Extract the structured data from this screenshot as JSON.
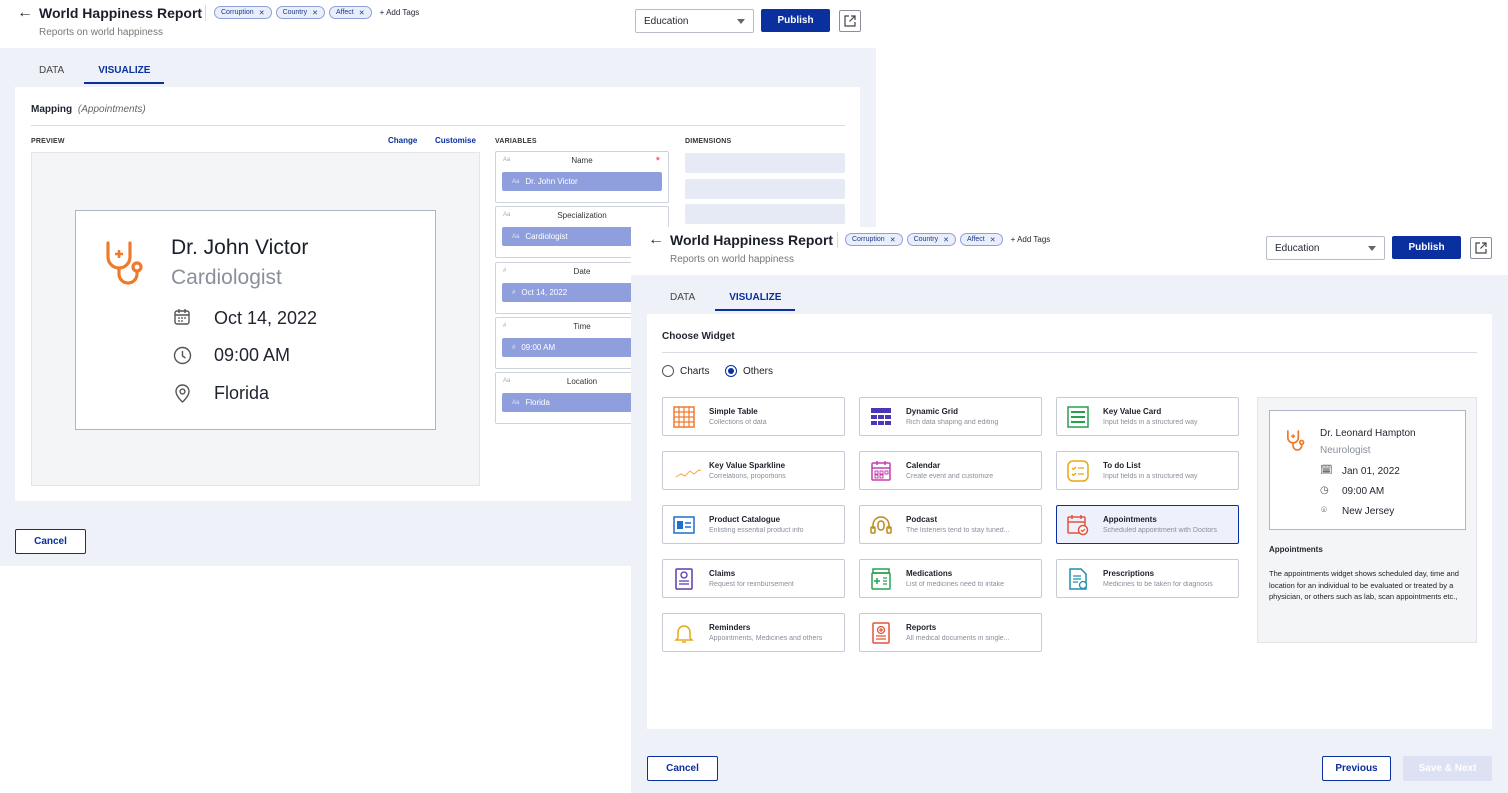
{
  "report": {
    "title": "World Happiness Report",
    "subtitle": "Reports on world happiness",
    "tags": [
      "Corruption",
      "Country",
      "Affect"
    ],
    "add_tags": "+ Add Tags",
    "category": "Education",
    "publish": "Publish"
  },
  "tabs": [
    "DATA",
    "VISUALIZE"
  ],
  "mapping": {
    "title": "Mapping",
    "context": "(Appointments)",
    "preview_label": "PREVIEW",
    "change": "Change",
    "customise": "Customise",
    "variables_label": "VARIABLES",
    "dimensions_label": "DIMENSIONS",
    "preview_card": {
      "name": "Dr. John Victor",
      "role": "Cardiologist",
      "date": "Oct 14, 2022",
      "time": "09:00 AM",
      "location": "Florida"
    },
    "variables": [
      {
        "type": "Aa",
        "label": "Name",
        "required": "*",
        "value": "Dr. John Victor"
      },
      {
        "type": "Aa",
        "label": "Specialization",
        "value": "Cardiologist"
      },
      {
        "type": "#",
        "label": "Date",
        "value": "Oct 14, 2022"
      },
      {
        "type": "#",
        "label": "Time",
        "value": "09:00 AM"
      },
      {
        "type": "Aa",
        "label": "Location",
        "value": "Florida"
      }
    ],
    "cancel": "Cancel"
  },
  "widget": {
    "title": "Choose Widget",
    "options": [
      "Charts",
      "Others"
    ],
    "selected_option": "Others",
    "cards": [
      {
        "name": "Simple Table",
        "desc": "Collections of data",
        "icon": "table-icon",
        "color": "#f07a2a"
      },
      {
        "name": "Dynamic Grid",
        "desc": "Rich data shaping and editing",
        "icon": "grid-icon",
        "color": "#4a37b8"
      },
      {
        "name": "Key Value Card",
        "desc": "Input fields in a structured way",
        "icon": "key-value-card-icon",
        "color": "#27a050"
      },
      {
        "name": "Key Value Sparkline",
        "desc": "Correlations, proportions",
        "icon": "sparkline-icon",
        "color": "#f2a64a"
      },
      {
        "name": "Calendar",
        "desc": "Create event and customize",
        "icon": "calendar-icon",
        "color": "#c43fb0"
      },
      {
        "name": "To do List",
        "desc": "Input fields in a structured way",
        "icon": "todo-icon",
        "color": "#e6a817"
      },
      {
        "name": "Product Catalogue",
        "desc": "Enlisting essential product info",
        "icon": "catalogue-icon",
        "color": "#1f6fd1"
      },
      {
        "name": "Podcast",
        "desc": "The listeners tend to stay tuned...",
        "icon": "podcast-icon",
        "color": "#b98a1c"
      },
      {
        "name": "Appointments",
        "desc": "Scheduled appointment with Doctors",
        "icon": "appointment-icon",
        "color": "#e2553a"
      },
      {
        "name": "Claims",
        "desc": "Request for reimbursement",
        "icon": "claims-icon",
        "color": "#5a3bb0"
      },
      {
        "name": "Medications",
        "desc": "List of medicines need to intake",
        "icon": "medications-icon",
        "color": "#27a050"
      },
      {
        "name": "Prescriptions",
        "desc": "Medicines to be taken for diagnosis",
        "icon": "prescriptions-icon",
        "color": "#1f8fb0"
      },
      {
        "name": "Reminders",
        "desc": "Appointments, Medicines and others",
        "icon": "bell-icon",
        "color": "#e6a817"
      },
      {
        "name": "Reports",
        "desc": "All medical documents in single...",
        "icon": "reports-icon",
        "color": "#e2553a"
      }
    ],
    "selected_card": "Appointments",
    "side_preview": {
      "name": "Dr. Leonard Hampton",
      "role": "Neurologist",
      "date": "Jan 01, 2022",
      "time": "09:00 AM",
      "location": "New Jersey",
      "heading": "Appointments",
      "description": "The appointments widget shows scheduled day, time and location for an individual to be evaluated or treated by a physician, or others such as lab, scan appointments etc.,"
    },
    "cancel": "Cancel",
    "previous": "Previous",
    "save_next": "Save & Next"
  },
  "colors": {
    "primary": "#0a2f9e",
    "accent_orange": "#f07a2a",
    "chip": "#8f9fdd",
    "background": "#eef1f8"
  }
}
